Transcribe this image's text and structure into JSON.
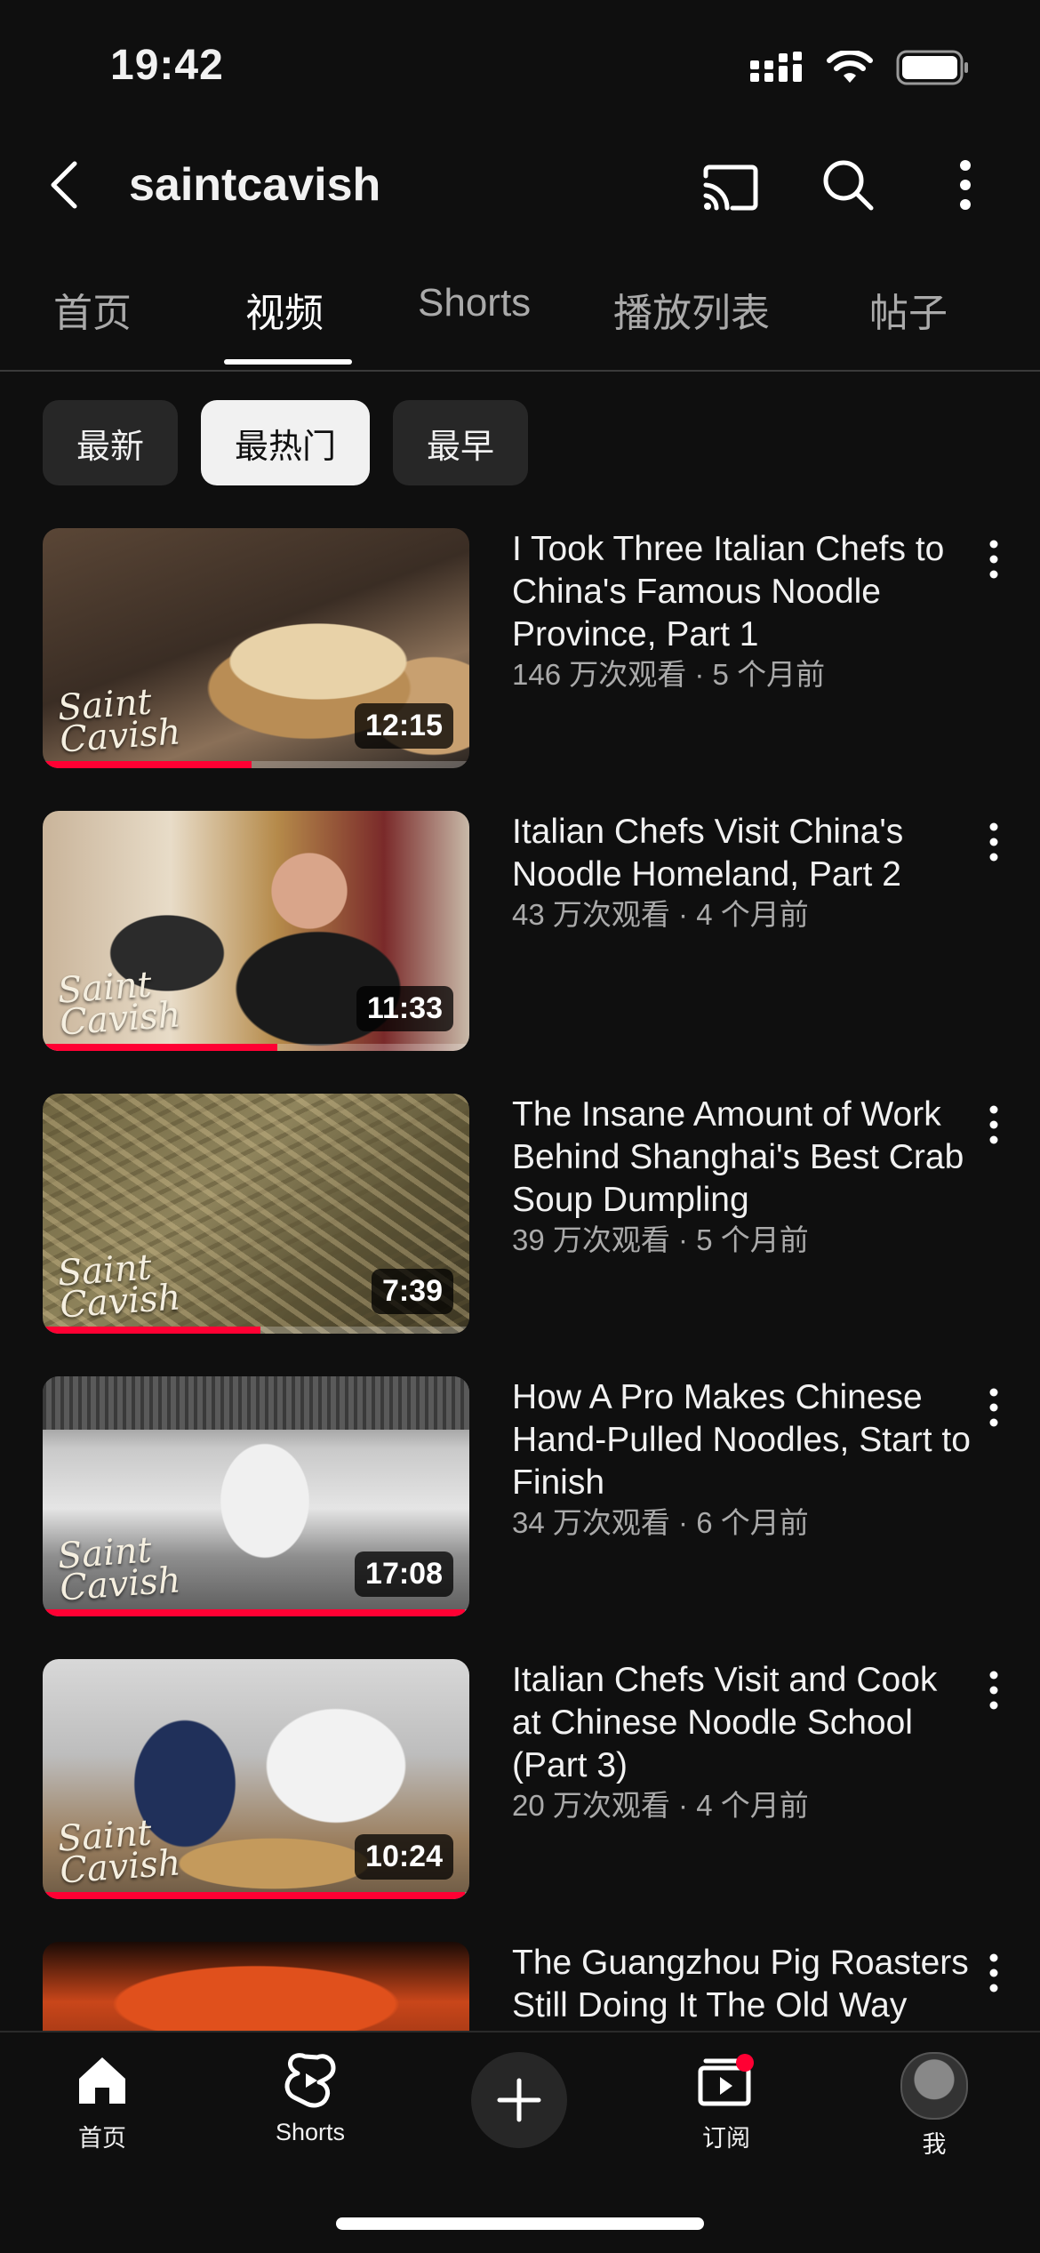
{
  "status_bar": {
    "time": "19:42"
  },
  "header": {
    "channel_name": "saintcavish"
  },
  "tabs": [
    {
      "label": "首页"
    },
    {
      "label": "视频"
    },
    {
      "label": "Shorts"
    },
    {
      "label": "播放列表"
    },
    {
      "label": "帖子"
    }
  ],
  "active_tab": "视频",
  "sort_chips": [
    {
      "label": "最新"
    },
    {
      "label": "最热门"
    },
    {
      "label": "最早"
    }
  ],
  "active_chip": "最热门",
  "videos": [
    {
      "title": "I Took Three Italian Chefs to China's Famous Noodle Province, Part 1",
      "meta": "146 万次观看 · 5 个月前",
      "duration": "12:15",
      "watched_fraction": 0.49
    },
    {
      "title": "Italian Chefs Visit China's Noodle Homeland, Part 2",
      "meta": "43 万次观看 · 4 个月前",
      "duration": "11:33",
      "watched_fraction": 0.55
    },
    {
      "title": "The Insane Amount of Work Behind Shanghai's Best Crab Soup Dumpling",
      "meta": "39 万次观看 · 5 个月前",
      "duration": "7:39",
      "watched_fraction": 0.51
    },
    {
      "title": "How A Pro Makes Chinese Hand-Pulled Noodles, Start to Finish",
      "meta": "34 万次观看 · 6 个月前",
      "duration": "17:08",
      "watched_fraction": 0.99
    },
    {
      "title": "Italian Chefs Visit and Cook at Chinese Noodle School (Part 3)",
      "meta": "20 万次观看 · 4 个月前",
      "duration": "10:24",
      "watched_fraction": 0.99
    },
    {
      "title": "The Guangzhou Pig Roasters Still Doing It The Old Way",
      "meta": "",
      "duration": "",
      "watched_fraction": 0
    }
  ],
  "thumbnail_logo": "Saint Cavish",
  "bottom_nav": {
    "home": "首页",
    "shorts": "Shorts",
    "subscriptions": "订阅",
    "you": "我"
  },
  "colors": {
    "background": "#0f0f0f",
    "progress": "#ff0033",
    "notification_dot": "#ff0033",
    "chip": "#272727",
    "chip_active": "#f1f1f1"
  }
}
